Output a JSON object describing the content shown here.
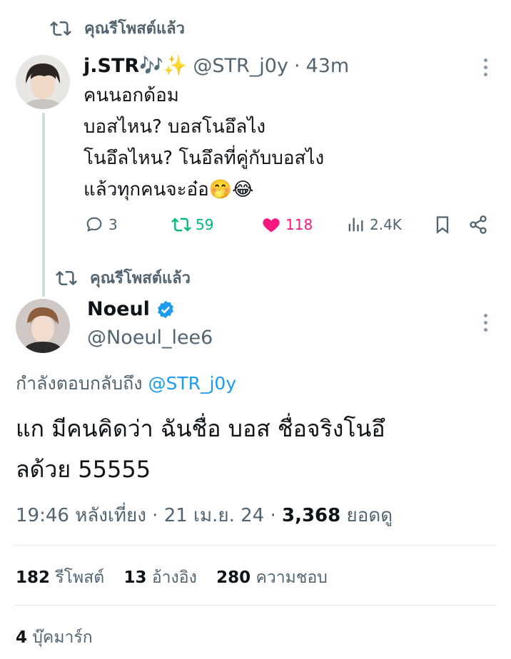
{
  "repost1": {
    "label": "คุณรีโพสต์แล้ว"
  },
  "tweet1": {
    "name": "j.STR🎶✨",
    "handle": "@STR_j0y",
    "sep": "·",
    "time": "43m",
    "lines": [
      "คนนอกด้อม",
      "บอสไหน? บอสโนอึลไง",
      "โนอึลไหน? โนอึลที่คู่กับบอสไง",
      "แล้วทุกคนจะอ๋อ🤭😂"
    ],
    "replies": "3",
    "reposts": "59",
    "likes": "118",
    "views": "2.4K"
  },
  "repost2": {
    "label": "คุณรีโพสต์แล้ว"
  },
  "tweet2": {
    "name": "Noeul",
    "handle": "@Noeul_lee6",
    "reply_prefix": "กำลังตอบกลับถึง",
    "reply_to": "@STR_j0y",
    "text_line1": "แก มีคนคิดว่า ฉันชื่อ บอส ชื่อจริงโนอึ",
    "text_line2": "ลด้วย 55555",
    "meta_time": "19:46 หลังเที่ยง · 21 เม.ย. 24 ·",
    "meta_views_count": "3,368",
    "meta_views_label": "ยอดดู",
    "stats": {
      "reposts_count": "182",
      "reposts_label": "รีโพสต์",
      "quotes_count": "13",
      "quotes_label": "อ้างอิง",
      "likes_count": "280",
      "likes_label": "ความชอบ",
      "bookmarks_count": "4",
      "bookmarks_label": "บุ๊คมาร์ก"
    }
  },
  "colors": {
    "repost_green": "#00ba7c",
    "like_pink": "#f91880",
    "link_blue": "#1d9bf0",
    "verified_blue": "#1d9bf0"
  }
}
